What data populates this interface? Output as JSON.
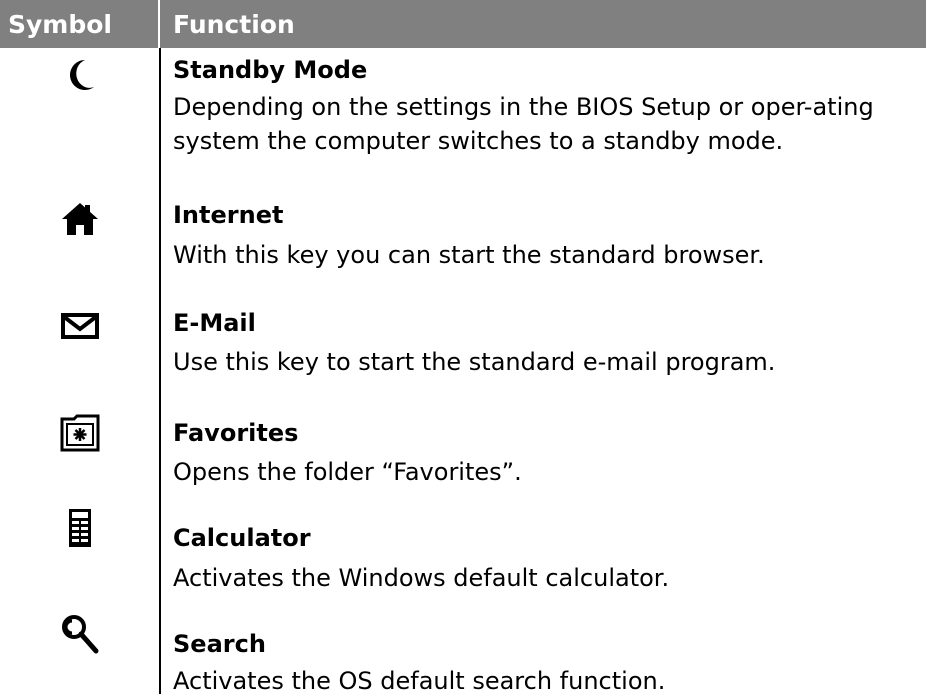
{
  "table": {
    "headers": {
      "symbol": "Symbol",
      "function": "Function"
    },
    "rows": [
      {
        "icon": "moon-icon",
        "title": "Standby Mode",
        "description": "Depending on the settings in the BIOS Setup or oper-ating system the computer switches to a standby mode."
      },
      {
        "icon": "home-icon",
        "title": "Internet",
        "description": "With this key you can start the standard browser."
      },
      {
        "icon": "mail-icon",
        "title": "E-Mail",
        "description": "Use this key to start the standard e-mail program."
      },
      {
        "icon": "favorites-folder-icon",
        "title": "Favorites",
        "description": "Opens the folder “Favorites”."
      },
      {
        "icon": "calculator-icon",
        "title": "Calculator",
        "description": "Activates the Windows default calculator."
      },
      {
        "icon": "search-icon",
        "title": "Search",
        "description": "Activates the OS default search function."
      }
    ]
  }
}
